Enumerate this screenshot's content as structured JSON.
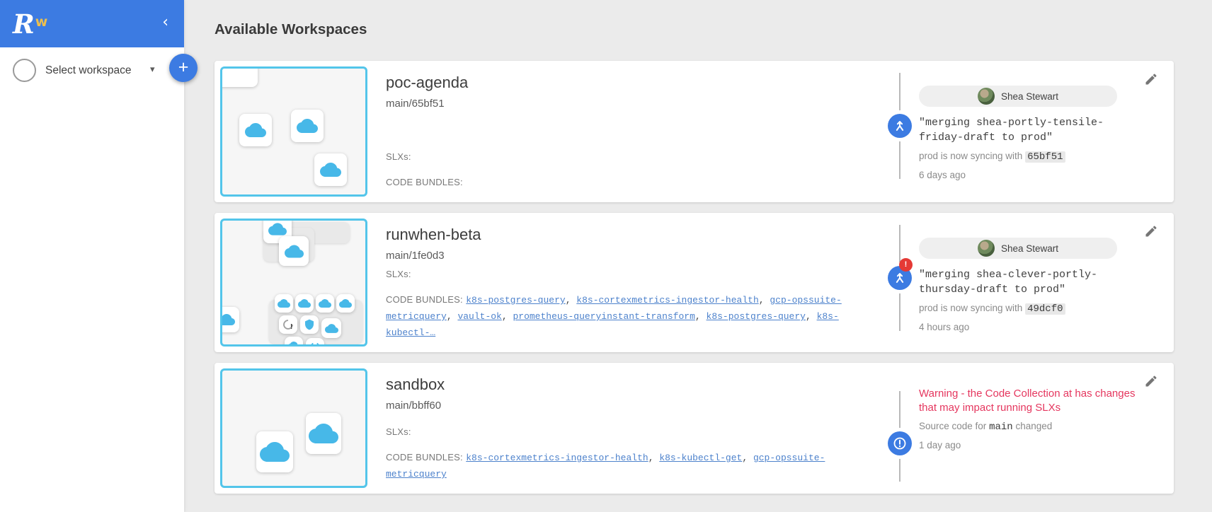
{
  "colors": {
    "primary_blue": "#3c7be2",
    "thumbnail_border": "#53c5ea",
    "cloud_blue": "#47b8e8",
    "link_blue": "#4d82cc",
    "warning_red": "#e5365e",
    "badge_red": "#e53935"
  },
  "sidebar": {
    "logo_r": "R",
    "logo_w": "w",
    "collapse_icon": "‹",
    "workspace_select": {
      "label": "Select workspace",
      "caret_icon": "▾"
    },
    "add_button_icon": "+"
  },
  "page": {
    "title": "Available Workspaces"
  },
  "labels": {
    "slxs": "SLXs:",
    "code_bundles": "CODE BUNDLES:"
  },
  "workspaces": [
    {
      "name": "poc-agenda",
      "ref": "main/65bf51",
      "bundles": [],
      "activity": {
        "user": "Shea Stewart",
        "message": "\"merging shea-portly-tensile-friday-draft to prod\"",
        "detail_prefix": "prod is now syncing with",
        "detail_code": "65bf51",
        "time": "6 days ago",
        "icon": "merge"
      }
    },
    {
      "name": "runwhen-beta",
      "ref": "main/1fe0d3",
      "bundles": [
        "k8s-postgres-query",
        "k8s-cortexmetrics-ingestor-health",
        "gcp-opssuite-metricquery",
        "vault-ok",
        "prometheus-queryinstant-transform",
        "k8s-postgres-query",
        "k8s-kubectl-…"
      ],
      "activity": {
        "user": "Shea Stewart",
        "badge": "!",
        "message": "\"merging shea-clever-portly-thursday-draft to prod\"",
        "detail_prefix": "prod is now syncing with",
        "detail_code": "49dcf0",
        "time": "4 hours ago",
        "icon": "merge"
      }
    },
    {
      "name": "sandbox",
      "ref": "main/bbff60",
      "bundles": [
        "k8s-cortexmetrics-ingestor-health",
        "k8s-kubectl-get",
        "gcp-opssuite-metricquery"
      ],
      "activity": {
        "warning": "Warning - the Code Collection at has changes that may impact running SLXs",
        "detail_prefix": "Source code for",
        "detail_code": "main",
        "detail_suffix": "changed",
        "time": "1 day ago",
        "icon": "alert"
      }
    }
  ]
}
